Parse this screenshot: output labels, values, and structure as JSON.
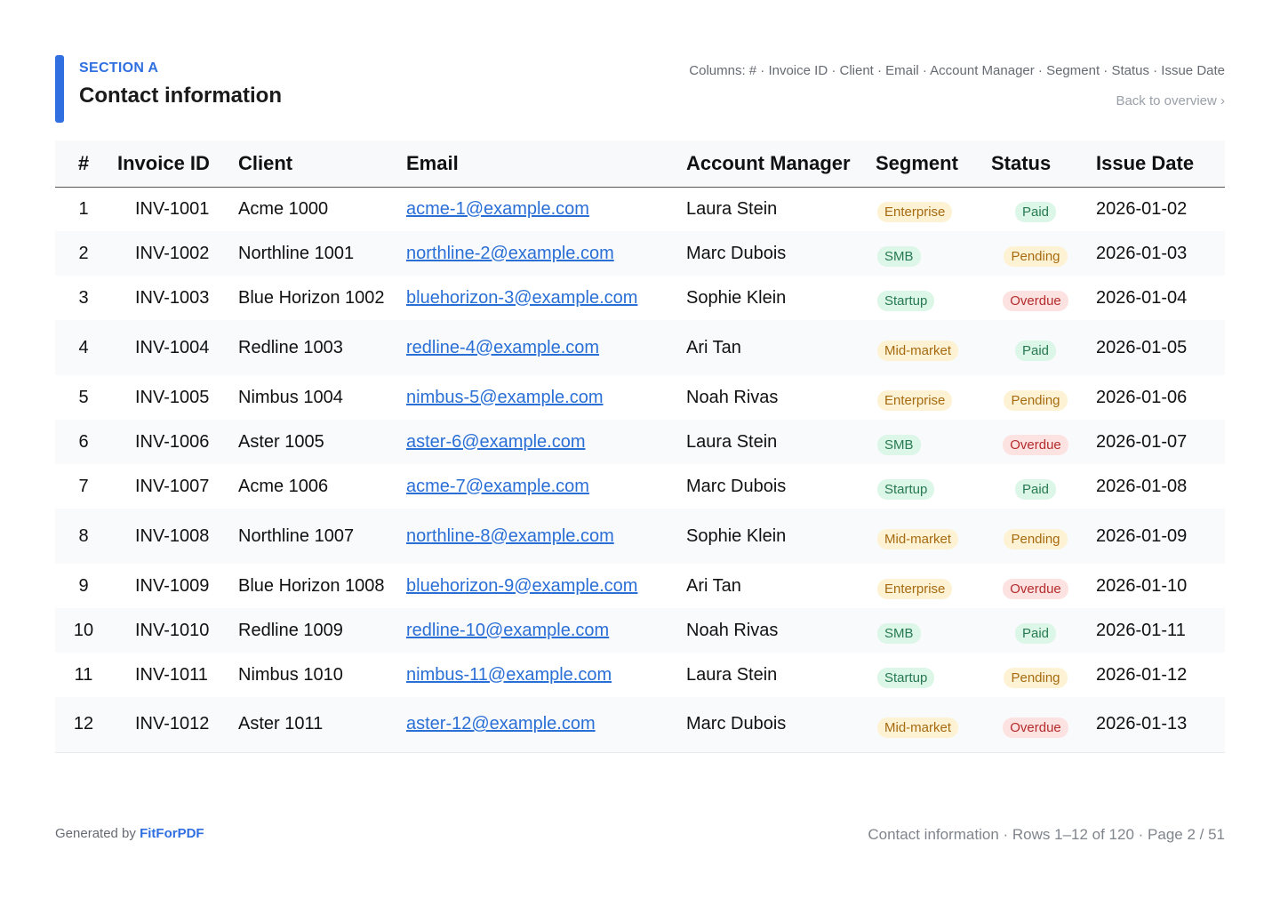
{
  "header": {
    "section_label": "SECTION A",
    "title": "Contact information",
    "columns_note": "Columns: # · Invoice ID · Client · Email · Account Manager · Segment · Status · Issue Date",
    "back_link": "Back to overview ›"
  },
  "table": {
    "columns": [
      "#",
      "Invoice ID",
      "Client",
      "Email",
      "Account Manager",
      "Segment",
      "Status",
      "Issue Date"
    ],
    "rows": [
      {
        "num": "1",
        "invoice": "INV-1001",
        "client": "Acme 1000",
        "email": "acme-1@example.com",
        "manager": "Laura Stein",
        "segment": "Enterprise",
        "status": "Paid",
        "date": "2026-01-02"
      },
      {
        "num": "2",
        "invoice": "INV-1002",
        "client": "Northline 1001",
        "email": "northline-2@example.com",
        "manager": "Marc Dubois",
        "segment": "SMB",
        "status": "Pending",
        "date": "2026-01-03"
      },
      {
        "num": "3",
        "invoice": "INV-1003",
        "client": "Blue Horizon 1002",
        "email": "bluehorizon-3@example.com",
        "manager": "Sophie Klein",
        "segment": "Startup",
        "status": "Overdue",
        "date": "2026-01-04"
      },
      {
        "num": "4",
        "invoice": "INV-1004",
        "client": "Redline 1003",
        "email": "redline-4@example.com",
        "manager": "Ari Tan",
        "segment": "Mid-market",
        "status": "Paid",
        "date": "2026-01-05"
      },
      {
        "num": "5",
        "invoice": "INV-1005",
        "client": "Nimbus 1004",
        "email": "nimbus-5@example.com",
        "manager": "Noah Rivas",
        "segment": "Enterprise",
        "status": "Pending",
        "date": "2026-01-06"
      },
      {
        "num": "6",
        "invoice": "INV-1006",
        "client": "Aster 1005",
        "email": "aster-6@example.com",
        "manager": "Laura Stein",
        "segment": "SMB",
        "status": "Overdue",
        "date": "2026-01-07"
      },
      {
        "num": "7",
        "invoice": "INV-1007",
        "client": "Acme 1006",
        "email": "acme-7@example.com",
        "manager": "Marc Dubois",
        "segment": "Startup",
        "status": "Paid",
        "date": "2026-01-08"
      },
      {
        "num": "8",
        "invoice": "INV-1008",
        "client": "Northline 1007",
        "email": "northline-8@example.com",
        "manager": "Sophie Klein",
        "segment": "Mid-market",
        "status": "Pending",
        "date": "2026-01-09"
      },
      {
        "num": "9",
        "invoice": "INV-1009",
        "client": "Blue Horizon 1008",
        "email": "bluehorizon-9@example.com",
        "manager": "Ari Tan",
        "segment": "Enterprise",
        "status": "Overdue",
        "date": "2026-01-10"
      },
      {
        "num": "10",
        "invoice": "INV-1010",
        "client": "Redline 1009",
        "email": "redline-10@example.com",
        "manager": "Noah Rivas",
        "segment": "SMB",
        "status": "Paid",
        "date": "2026-01-11"
      },
      {
        "num": "11",
        "invoice": "INV-1011",
        "client": "Nimbus 1010",
        "email": "nimbus-11@example.com",
        "manager": "Laura Stein",
        "segment": "Startup",
        "status": "Pending",
        "date": "2026-01-12"
      },
      {
        "num": "12",
        "invoice": "INV-1012",
        "client": "Aster 1011",
        "email": "aster-12@example.com",
        "manager": "Marc Dubois",
        "segment": "Mid-market",
        "status": "Overdue",
        "date": "2026-01-13"
      }
    ]
  },
  "footer": {
    "generated_by": "Generated by",
    "brand": "FitForPDF",
    "page_info": "Contact information · Rows 1–12 of 120 · Page 2 / 51"
  },
  "colors": {
    "accent": "#2f6fe0",
    "link": "#2a6fd6",
    "paid": "#287a52",
    "pending": "#a66a10",
    "overdue": "#b52b2b"
  }
}
